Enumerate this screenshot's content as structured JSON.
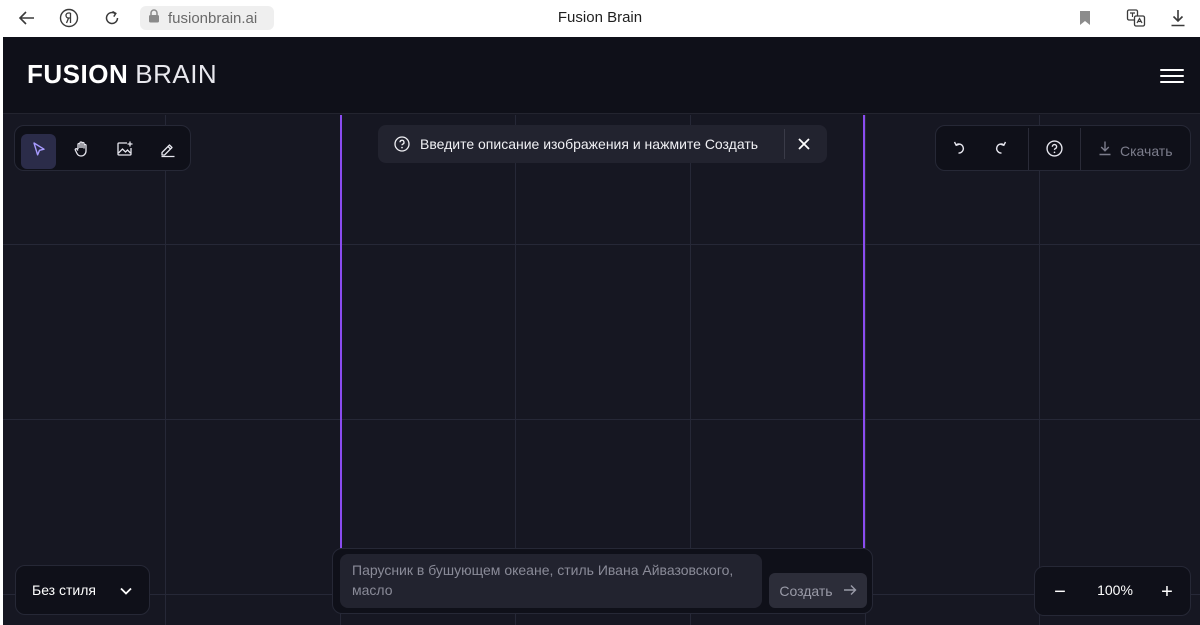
{
  "browser": {
    "url": "fusionbrain.ai",
    "title": "Fusion Brain",
    "icons": [
      "back-arrow-icon",
      "yandex-icon",
      "reload-icon",
      "lock-icon",
      "bookmark-icon",
      "translate-icon",
      "download-icon"
    ]
  },
  "app": {
    "logo_bold": "FUSION",
    "logo_light": "BRAIN",
    "hint_text": "Введите описание изображения и нажмите Создать",
    "tools": [
      "cursor-icon",
      "hand-icon",
      "image-add-icon",
      "eraser-icon"
    ],
    "download_label": "Скачать",
    "style_label": "Без стиля",
    "prompt_placeholder": "Парусник в бушующем океане, стиль Ивана Айвазовского, масло",
    "create_label": "Создать",
    "zoom_level": "100%",
    "zoom_minus": "−",
    "zoom_plus": "+"
  },
  "colors": {
    "background": "#161722",
    "header": "#0f1019",
    "frame": "#8a4cf0",
    "active_tool": "#2b2c49"
  }
}
